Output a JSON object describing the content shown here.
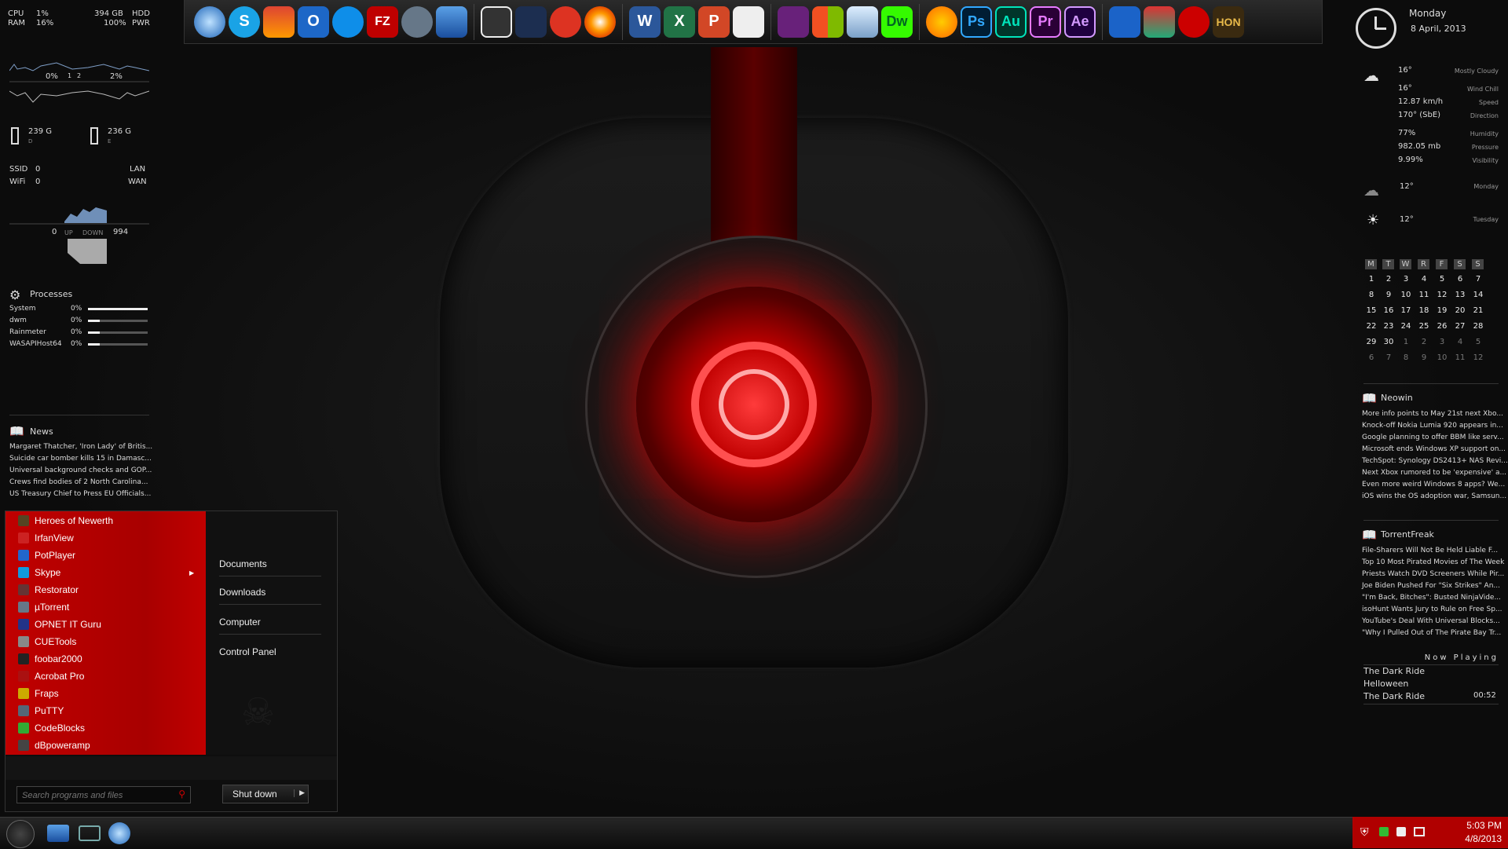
{
  "colors": {
    "accent": "#c00000",
    "panel": "#111111",
    "text": "#dddddd"
  },
  "left_panel": {
    "cpu": {
      "label": "CPU",
      "value": "1%",
      "disk": "394 GB",
      "disk_label": "HDD"
    },
    "ram": {
      "label": "RAM",
      "value": "16%",
      "power": "100%",
      "power_label": "PWR"
    },
    "graph_labels": [
      "0%",
      "1",
      "2",
      "2%"
    ],
    "drives": [
      {
        "size": "239 G",
        "letter": "D"
      },
      {
        "size": "236 G",
        "letter": "E"
      }
    ],
    "net": {
      "ssid_label": "SSID",
      "ssid_val": "0",
      "lan": "LAN",
      "wifi_label": "WiFi",
      "wifi_val": "0",
      "wan": "WAN"
    },
    "traffic": {
      "up_val": "0",
      "up": "UP",
      "down": "DOWN",
      "down_val": "994"
    },
    "processes_title": "Processes",
    "processes": [
      {
        "name": "System",
        "pct": "0%",
        "fill": 1.0
      },
      {
        "name": "dwm",
        "pct": "0%",
        "fill": 0.2
      },
      {
        "name": "Rainmeter",
        "pct": "0%",
        "fill": 0.2
      },
      {
        "name": "WASAPIHost64",
        "pct": "0%",
        "fill": 0.2
      }
    ],
    "news_title": "News",
    "news": [
      "Margaret Thatcher, 'Iron Lady' of Britis...",
      "Suicide car bomber kills 15 in Damasc...",
      "Universal background checks and GOP...",
      "Crews find bodies of 2 North Carolina...",
      "US Treasury Chief to Press EU Officials..."
    ]
  },
  "dock": {
    "icons": [
      "browser-icon",
      "skype-icon",
      "winamp-icon",
      "outlook-icon",
      "teamviewer-icon",
      "filezilla-icon",
      "utorrent-icon",
      "remote-desktop-icon",
      "foobar-icon",
      "winamp-bolt-icon",
      "flash-icon",
      "cd-icon",
      "word-icon",
      "excel-icon",
      "powerpoint-icon",
      "acrobat-icon",
      "visual-studio-icon",
      "windows-icon",
      "virtualbox-icon",
      "dreamweaver-icon",
      "fl-studio-icon",
      "photoshop-icon",
      "audition-icon",
      "premiere-icon",
      "after-effects-icon",
      "calculator-icon",
      "ccleaner-icon",
      "pokerstars-icon",
      "hon-icon"
    ],
    "labels": {
      "s": "S",
      "o": "O",
      "fz": "FZ",
      "w": "W",
      "x": "X",
      "p": "P",
      "dw": "Dw",
      "ps": "Ps",
      "au": "Au",
      "pr": "Pr",
      "ae": "Ae",
      "hon": "HON"
    }
  },
  "right_panel": {
    "day": "Monday",
    "date": "8 April, 2013",
    "weather": [
      {
        "val": "16°",
        "label": "Mostly Cloudy"
      },
      {
        "val": "16°",
        "label": "Wind Chill"
      },
      {
        "val": "12.87 km/h",
        "label": "Speed"
      },
      {
        "val": "170° (SbE)",
        "label": "Direction"
      },
      {
        "val": "77%",
        "label": "Humidity"
      },
      {
        "val": "982.05 mb",
        "label": "Pressure"
      },
      {
        "val": "9.99%",
        "label": "Visibility"
      }
    ],
    "forecast": [
      {
        "val": "12°",
        "label": "Monday"
      },
      {
        "val": "12°",
        "label": "Tuesday"
      }
    ],
    "calendar": {
      "headers": [
        "M",
        "T",
        "W",
        "R",
        "F",
        "S",
        "S"
      ],
      "weeks": [
        [
          "1",
          "2",
          "3",
          "4",
          "5",
          "6",
          "7"
        ],
        [
          "8",
          "9",
          "10",
          "11",
          "12",
          "13",
          "14"
        ],
        [
          "15",
          "16",
          "17",
          "18",
          "19",
          "20",
          "21"
        ],
        [
          "22",
          "23",
          "24",
          "25",
          "26",
          "27",
          "28"
        ],
        [
          "29",
          "30",
          "1",
          "2",
          "3",
          "4",
          "5"
        ],
        [
          "6",
          "7",
          "8",
          "9",
          "10",
          "11",
          "12"
        ]
      ]
    },
    "neowin_title": "Neowin",
    "neowin": [
      "More info points to May 21st next Xbo...",
      "Knock-off Nokia Lumia 920 appears in...",
      "Google planning to offer BBM like serv...",
      "Microsoft ends Windows XP support on...",
      "TechSpot: Synology DS2413+ NAS Revi...",
      "Next Xbox rumored to be 'expensive' a...",
      "Even more weird Windows 8 apps? We...",
      "iOS wins the OS adoption war, Samsun..."
    ],
    "tf_title": "TorrentFreak",
    "torrentfreak": [
      "File-Sharers Will Not Be Held Liable F...",
      "Top 10 Most Pirated Movies of The Week",
      "Priests Watch DVD Screeners While Pir...",
      "Joe Biden Pushed For \"Six Strikes\" An...",
      "\"I'm Back, Bitches\": Busted NinjaVide...",
      "isoHunt Wants Jury to Rule on Free Sp...",
      "YouTube's Deal With Universal Blocks...",
      "\"Why I Pulled Out of The Pirate Bay Tr..."
    ],
    "now_playing": {
      "title": "Now Playing",
      "track": "The Dark Ride",
      "artist": "Helloween",
      "album": "The Dark Ride",
      "time": "00:52"
    }
  },
  "start_menu": {
    "programs": [
      {
        "name": "Heroes of Newerth",
        "color": "#554422"
      },
      {
        "name": "IrfanView",
        "color": "#cc2222"
      },
      {
        "name": "PotPlayer",
        "color": "#2266cc"
      },
      {
        "name": "Skype",
        "color": "#1199dd",
        "arrow": "▶"
      },
      {
        "name": "Restorator",
        "color": "#663333"
      },
      {
        "name": "µTorrent",
        "color": "#667788"
      },
      {
        "name": "OPNET IT Guru",
        "color": "#223388"
      },
      {
        "name": "CUETools",
        "color": "#888888"
      },
      {
        "name": "foobar2000",
        "color": "#222222"
      },
      {
        "name": "Acrobat Pro",
        "color": "#aa1111"
      },
      {
        "name": "Fraps",
        "color": "#ccaa00"
      },
      {
        "name": "PuTTY",
        "color": "#556677"
      },
      {
        "name": "CodeBlocks",
        "color": "#33aa33"
      },
      {
        "name": "dBpoweramp",
        "color": "#444444"
      }
    ],
    "right_links": [
      "Documents",
      "Downloads",
      "Computer",
      "Control Panel"
    ],
    "search_placeholder": "Search programs and files",
    "shutdown": "Shut down",
    "shutdown_arrow": "▶"
  },
  "taskbar": {
    "clock_time": "5:03 PM",
    "clock_date": "4/8/2013"
  }
}
